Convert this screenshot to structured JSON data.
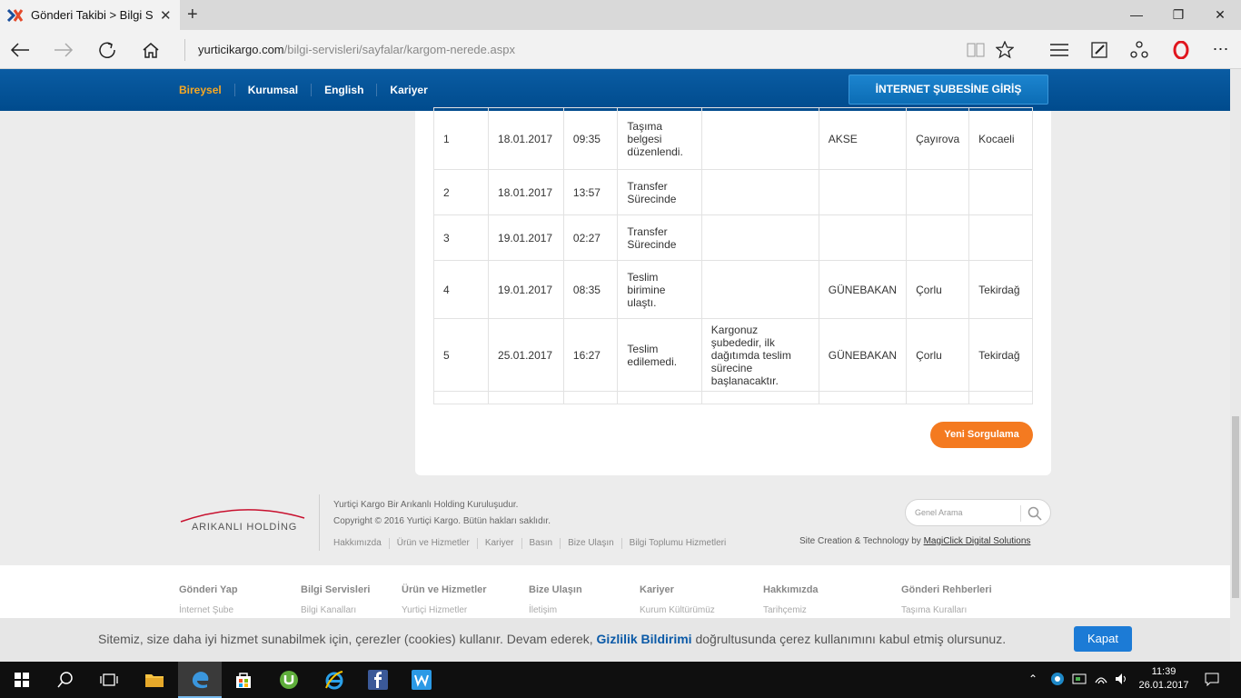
{
  "browser": {
    "tab_title": "Gönderi Takibi > Bilgi S",
    "url_host": "yurticikargo.com",
    "url_path": "/bilgi-servisleri/sayfalar/kargom-nerede.aspx"
  },
  "header": {
    "nav": [
      "Bireysel",
      "Kurumsal",
      "English",
      "Kariyer"
    ],
    "internet_branch_button": "İNTERNET ŞUBESİNE GİRİŞ"
  },
  "tracking_table": {
    "rows": [
      {
        "no": "1",
        "date": "18.01.2017",
        "time": "09:35",
        "status": "Taşıma belgesi düzenlendi.",
        "note": "",
        "unit": "AKSE",
        "district": "Çayırova",
        "city": "Kocaeli"
      },
      {
        "no": "2",
        "date": "18.01.2017",
        "time": "13:57",
        "status": "Transfer Sürecinde",
        "note": "",
        "unit": "",
        "district": "",
        "city": ""
      },
      {
        "no": "3",
        "date": "19.01.2017",
        "time": "02:27",
        "status": "Transfer Sürecinde",
        "note": "",
        "unit": "",
        "district": "",
        "city": ""
      },
      {
        "no": "4",
        "date": "19.01.2017",
        "time": "08:35",
        "status": "Teslim birimine ulaştı.",
        "note": "",
        "unit": "GÜNEBAKAN",
        "district": "Çorlu",
        "city": "Tekirdağ"
      },
      {
        "no": "5",
        "date": "25.01.2017",
        "time": "16:27",
        "status": "Teslim edilemedi.",
        "note": "Kargonuz şubededir, ilk dağıtımda teslim sürecine başlanacaktır.",
        "unit": "GÜNEBAKAN",
        "district": "Çorlu",
        "city": "Tekirdağ"
      }
    ],
    "new_query_button": "Yeni Sorgulama"
  },
  "footer": {
    "logo_text": "ARIKANLI HOLDİNG",
    "line1": "Yurtiçi Kargo Bir Arıkanlı Holding Kuruluşudur.",
    "line2": "Copyright © 2016 Yurtiçi Kargo. Bütün hakları saklıdır.",
    "links": [
      "Hakkımızda",
      "Ürün ve Hizmetler",
      "Kariyer",
      "Basın",
      "Bize Ulaşın",
      "Bilgi Toplumu Hizmetleri"
    ],
    "search_placeholder": "Genel Arama",
    "credit_prefix": "Site Creation & Technology by",
    "credit_link": "MagiClick Digital Solutions"
  },
  "sitemap": [
    {
      "heading": "Gönderi Yap",
      "first": "İnternet Şube"
    },
    {
      "heading": "Bilgi Servisleri",
      "first": "Bilgi Kanalları"
    },
    {
      "heading": "Ürün ve Hizmetler",
      "first": "Yurtiçi Hizmetler"
    },
    {
      "heading": "Bize Ulaşın",
      "first": "İletişim"
    },
    {
      "heading": "Kariyer",
      "first": "Kurum Kültürümüz"
    },
    {
      "heading": "Hakkımızda",
      "first": "Tarihçemiz"
    },
    {
      "heading": "Gönderi Rehberleri",
      "first": "Taşıma Kuralları"
    }
  ],
  "cookie": {
    "text_before": "Sitemiz, size daha iyi hizmet sunabilmek için, çerezler (cookies) kullanır. Devam ederek,",
    "link": "Gizlilik Bildirimi",
    "text_after": "doğrultusunda çerez kullanımını kabul etmiş olursunuz.",
    "button": "Kapat"
  },
  "taskbar": {
    "time": "11:39",
    "date": "26.01.2017"
  },
  "colors": {
    "header_blue": "#004b8d",
    "active_nav": "#f7a823",
    "orange_button": "#f47a20",
    "cookie_button": "#1c7bd6"
  }
}
